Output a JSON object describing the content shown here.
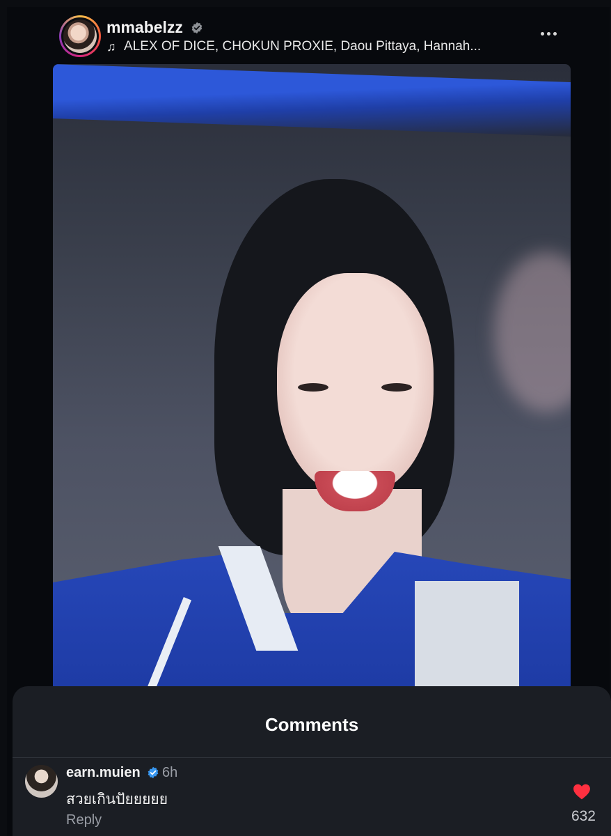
{
  "post": {
    "username": "mmabelzz",
    "music_note_icon": "music-note-icon",
    "music": "ALEX OF DICE, CHOKUN PROXIE, Daou Pittaya, Hannah...",
    "more_icon": "more-horizontal-icon"
  },
  "comments_sheet": {
    "title": "Comments",
    "comments": [
      {
        "username": "earn.muien",
        "time": "6h",
        "text": "สวยเกินปัยยยยย",
        "reply_label": "Reply",
        "likes": "632",
        "liked": true
      }
    ]
  },
  "colors": {
    "background": "#0b0d11",
    "sheet": "#1b1e24",
    "verified": "#3897f0",
    "heart": "#ff3040",
    "muted_text": "#9a9ea6"
  }
}
